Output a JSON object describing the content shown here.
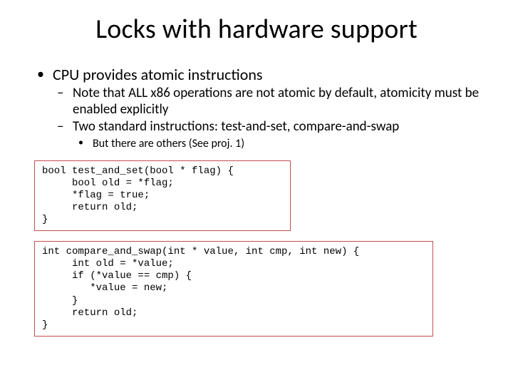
{
  "title": "Locks with hardware support",
  "b1": "CPU provides atomic instructions",
  "b1a": "Note that ALL x86 operations are not atomic by default, atomicity must be enabled explicitly",
  "b1b": "Two standard instructions: test-and-set, compare-and-swap",
  "b1b1": "But there are others (See proj. 1)",
  "code1": "bool test_and_set(bool * flag) {\n     bool old = *flag;\n     *flag = true;\n     return old;\n}",
  "code2": "int compare_and_swap(int * value, int cmp, int new) {\n     int old = *value;\n     if (*value == cmp) {\n        *value = new;\n     }\n     return old;\n}"
}
